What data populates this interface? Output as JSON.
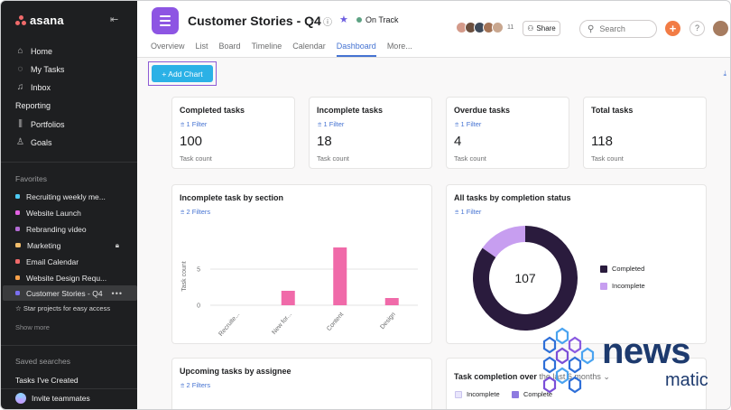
{
  "app": {
    "name": "asana"
  },
  "sidebar": {
    "nav": [
      {
        "label": "Home",
        "icon": "home-icon"
      },
      {
        "label": "My Tasks",
        "icon": "check-circle-icon"
      },
      {
        "label": "Inbox",
        "icon": "bell-icon"
      }
    ],
    "reporting_label": "Reporting",
    "reporting_items": [
      {
        "label": "Portfolios",
        "icon": "bar-chart-icon"
      },
      {
        "label": "Goals",
        "icon": "person-icon"
      }
    ],
    "favorites_label": "Favorites",
    "favorites": [
      {
        "label": "Recruiting weekly me...",
        "color": "#4ecbf4"
      },
      {
        "label": "Website Launch",
        "color": "#e362e3"
      },
      {
        "label": "Rebranding video",
        "color": "#b36bd4"
      },
      {
        "label": "Marketing",
        "color": "#f1bd6c",
        "locked": true
      },
      {
        "label": "Email Calendar",
        "color": "#f06a6a"
      },
      {
        "label": "Website Design Requ...",
        "color": "#f8a14a"
      },
      {
        "label": "Customer Stories - Q4",
        "color": "#7a6ff0",
        "active": true
      }
    ],
    "star_projects": "Star projects for easy access",
    "show_more": "Show more",
    "saved_searches_label": "Saved searches",
    "saved_searches": [
      {
        "label": "Tasks I've Created"
      }
    ],
    "invite": "Invite teammates"
  },
  "header": {
    "project_title": "Customer Stories - Q4",
    "status": "On Track",
    "status_color": "#5da283",
    "member_count": "11",
    "share_label": "Share",
    "search_placeholder": "Search",
    "add_icon": "+",
    "help_icon": "?",
    "tabs": [
      {
        "label": "Overview"
      },
      {
        "label": "List"
      },
      {
        "label": "Board"
      },
      {
        "label": "Timeline"
      },
      {
        "label": "Calendar"
      },
      {
        "label": "Dashboard",
        "active": true
      },
      {
        "label": "More..."
      }
    ]
  },
  "toolbar": {
    "add_chart_label": "+ Add Chart"
  },
  "stats": [
    {
      "title": "Completed tasks",
      "filter": "1 Filter",
      "value": "100",
      "unit": "Task count"
    },
    {
      "title": "Incomplete tasks",
      "filter": "1 Filter",
      "value": "18",
      "unit": "Task count"
    },
    {
      "title": "Overdue tasks",
      "filter": "1 Filter",
      "value": "4",
      "unit": "Task count"
    },
    {
      "title": "Total tasks",
      "filter": "",
      "value": "118",
      "unit": "Task count"
    }
  ],
  "cards": {
    "incomplete_by_section": {
      "title": "Incomplete task by section",
      "filter": "2 Filters"
    },
    "completion_status": {
      "title": "All tasks by completion status",
      "filter": "1 Filter",
      "center_value": "107"
    },
    "upcoming": {
      "title": "Upcoming tasks by assignee",
      "filter": "2 Filters"
    },
    "completion_over": {
      "title": "Task completion over",
      "dropdown": "the last 6 months",
      "legend": [
        {
          "label": "Incomplete",
          "color": "#e9e6fb"
        },
        {
          "label": "Complete",
          "color": "#8d7ae0"
        }
      ]
    }
  },
  "chart_data": [
    {
      "type": "bar",
      "title": "Incomplete task by section",
      "ylabel": "Task count",
      "categories": [
        "Recruite...",
        "New for...",
        "Content",
        "Design"
      ],
      "values": [
        0,
        2,
        8,
        1
      ],
      "ylim": [
        0,
        10
      ],
      "yticks": [
        0,
        5
      ],
      "color": "#f06aa9"
    },
    {
      "type": "pie",
      "title": "All tasks by completion status",
      "labels": [
        "Completed",
        "Incomplete"
      ],
      "values": [
        100,
        18
      ],
      "colors": [
        "#2a1b3d",
        "#c79ef0"
      ],
      "center_label": "107"
    }
  ],
  "watermark": {
    "line1": "news",
    "line2": "matic"
  }
}
